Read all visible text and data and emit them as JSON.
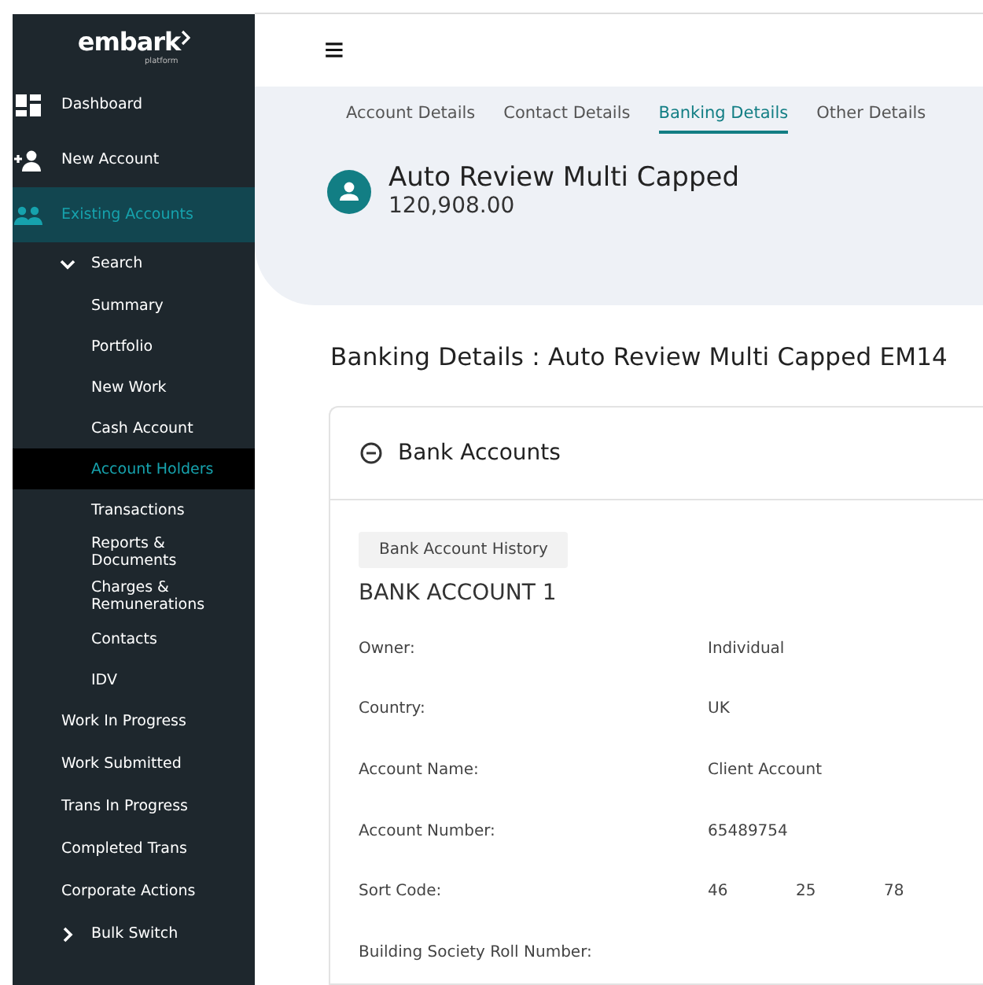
{
  "logo": {
    "name": "embark",
    "tagline": "platform"
  },
  "sidebar": {
    "items": [
      {
        "label": "Dashboard",
        "selected": false
      },
      {
        "label": "New Account",
        "selected": false
      },
      {
        "label": "Existing Accounts",
        "selected": true,
        "children": [
          {
            "label": "Search",
            "expanded": true,
            "selected": false,
            "children": [
              {
                "label": "Summary",
                "selected": false
              },
              {
                "label": "Portfolio",
                "selected": false
              },
              {
                "label": "New Work",
                "selected": false
              },
              {
                "label": "Cash Account",
                "selected": false
              },
              {
                "label": "Account Holders",
                "selected": true
              },
              {
                "label": "Transactions",
                "selected": false
              },
              {
                "label": "Reports &\nDocuments",
                "selected": false
              },
              {
                "label": "Charges &\nRemunerations",
                "selected": false
              },
              {
                "label": "Contacts",
                "selected": false
              },
              {
                "label": "IDV",
                "selected": false
              }
            ]
          },
          {
            "label": "Work In Progress",
            "selected": false
          },
          {
            "label": "Work Submitted",
            "selected": false
          },
          {
            "label": "Trans In Progress",
            "selected": false
          },
          {
            "label": "Completed Trans",
            "selected": false
          },
          {
            "label": "Corporate Actions",
            "selected": false
          },
          {
            "label": "Bulk Switch",
            "expanded": false,
            "selected": false
          }
        ]
      }
    ]
  },
  "header": {
    "menu_glyph": "≡"
  },
  "tabs": [
    {
      "label": "Account Details",
      "selected": false
    },
    {
      "label": "Contact Details",
      "selected": false
    },
    {
      "label": "Banking Details",
      "selected": true
    },
    {
      "label": "Other Details",
      "selected": false
    }
  ],
  "account": {
    "name": "Auto Review Multi Capped",
    "value": "120,908.00"
  },
  "page_heading": "Banking Details : Auto Review Multi Capped EM14",
  "bank_accounts": {
    "title": "Bank Accounts",
    "expanded": true,
    "history_button": "Bank Account History",
    "account_title": "BANK ACCOUNT 1",
    "fields": [
      {
        "label": "Owner:",
        "values": [
          "Individual"
        ]
      },
      {
        "label": "Country:",
        "values": [
          "UK"
        ]
      },
      {
        "label": "Account Name:",
        "values": [
          "Client Account"
        ]
      },
      {
        "label": "Account Number:",
        "values": [
          "65489754"
        ]
      },
      {
        "label": "Sort Code:",
        "values": [
          "46",
          "25",
          "78"
        ]
      },
      {
        "label": "Building Society Roll Number:"
      }
    ]
  }
}
